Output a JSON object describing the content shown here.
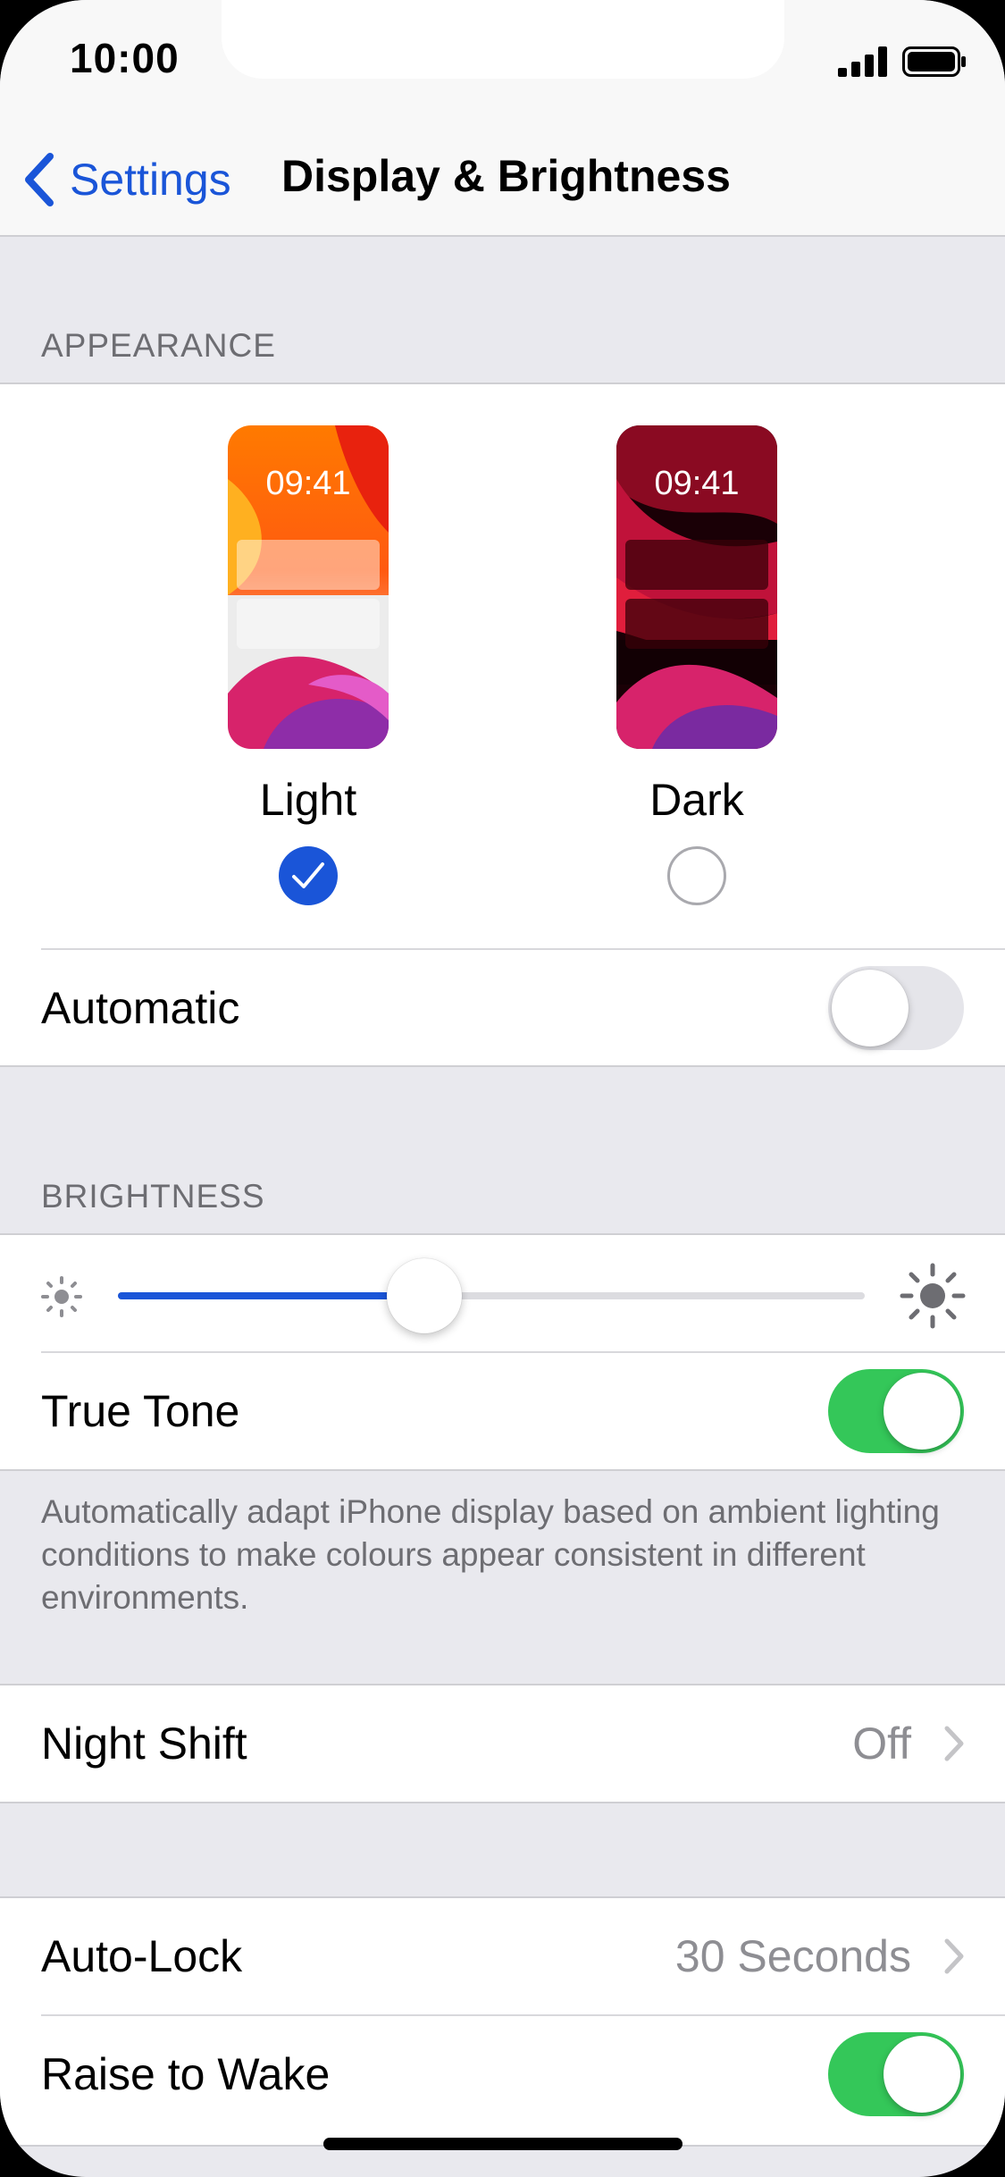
{
  "status_bar": {
    "time": "10:00"
  },
  "nav": {
    "back_label": "Settings",
    "title": "Display & Brightness"
  },
  "appearance": {
    "header": "APPEARANCE",
    "options": [
      {
        "label": "Light",
        "preview_time": "09:41",
        "selected": true
      },
      {
        "label": "Dark",
        "preview_time": "09:41",
        "selected": false
      }
    ],
    "automatic": {
      "label": "Automatic",
      "enabled": false
    }
  },
  "brightness": {
    "header": "BRIGHTNESS",
    "level": 0.41,
    "true_tone": {
      "label": "True Tone",
      "enabled": true
    },
    "footnote": "Automatically adapt iPhone display based on ambient lighting conditions to make colours appear consistent in different environments."
  },
  "night_shift": {
    "label": "Night Shift",
    "value": "Off"
  },
  "auto_lock": {
    "label": "Auto-Lock",
    "value": "30 Seconds"
  },
  "raise_to_wake": {
    "label": "Raise to Wake",
    "enabled": true
  },
  "colors": {
    "accent": "#1A55D8",
    "switch_on": "#34C759",
    "background": "#E9E9EE",
    "secondary_text": "#8E8E93"
  }
}
